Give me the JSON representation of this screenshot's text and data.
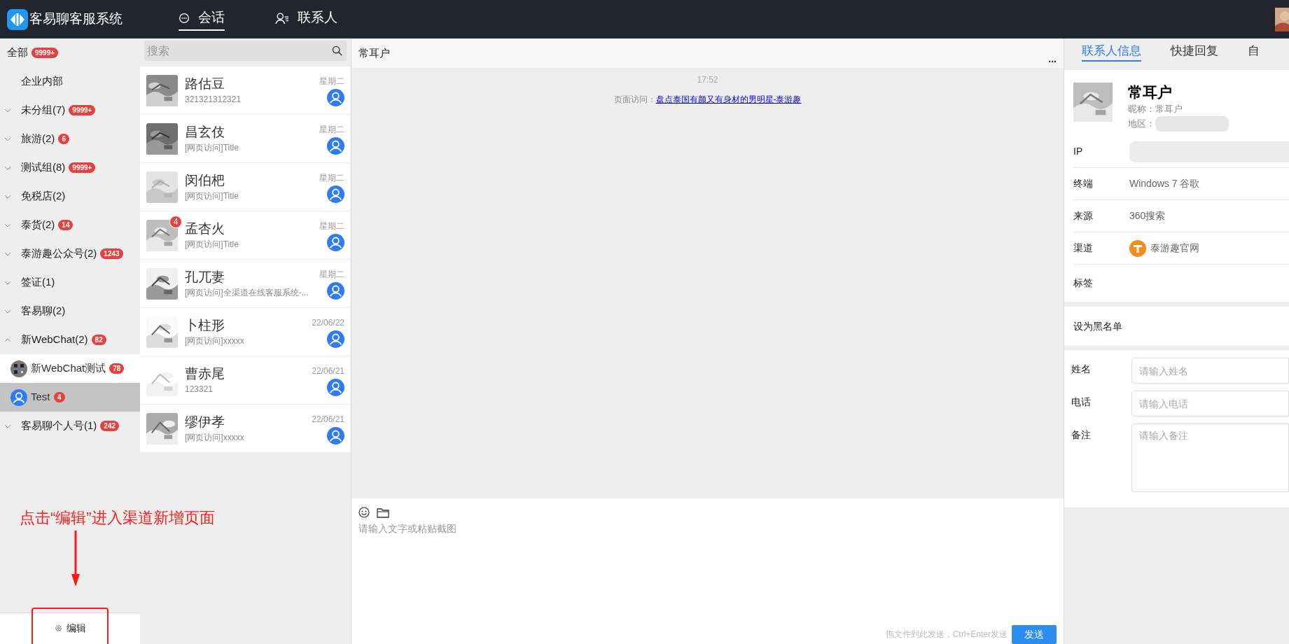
{
  "app": {
    "title": "客易聊客服系统"
  },
  "nav_tabs": [
    {
      "label": "会话",
      "kind": "chat",
      "selected": true
    },
    {
      "label": "联系人",
      "kind": "contacts",
      "selected": false
    }
  ],
  "sidebar": {
    "items": [
      {
        "label": "全部",
        "badge": "9999+",
        "kind": "plain",
        "selected": false
      },
      {
        "label": "企业内部",
        "kind": "plain",
        "selected": false
      },
      {
        "label": "未分组(7)",
        "badge": "9999+",
        "kind": "group",
        "expanded": false,
        "selected": false
      },
      {
        "label": "旅游(2)",
        "badge": "6",
        "kind": "group",
        "expanded": false,
        "selected": false
      },
      {
        "label": "测试组(8)",
        "badge": "9999+",
        "kind": "group",
        "expanded": false,
        "selected": false
      },
      {
        "label": "免税店(2)",
        "kind": "group",
        "expanded": false,
        "selected": false
      },
      {
        "label": "泰货(2)",
        "badge": "14",
        "kind": "group",
        "expanded": false,
        "selected": false
      },
      {
        "label": "泰游趣公众号(2)",
        "badge": "1243",
        "kind": "group",
        "expanded": false,
        "selected": false
      },
      {
        "label": "签证(1)",
        "kind": "group",
        "expanded": false,
        "selected": false
      },
      {
        "label": "客易聊(2)",
        "kind": "group",
        "expanded": false,
        "selected": false
      },
      {
        "label": "新WebChat(2)",
        "badge": "82",
        "kind": "group",
        "expanded": true,
        "selected": false,
        "children": [
          {
            "label": "新WebChat测试",
            "badge": "78",
            "kind": "qr",
            "selected": false
          },
          {
            "label": "Test",
            "badge": "4",
            "kind": "person",
            "selected": true
          }
        ]
      },
      {
        "label": "客易聊个人号(1)",
        "badge": "242",
        "kind": "group",
        "expanded": false,
        "selected": false
      }
    ],
    "edit_button": "编辑"
  },
  "search": {
    "placeholder": "搜索"
  },
  "conversations": [
    {
      "name": "路估豆",
      "preview": "321321312321",
      "time": "星期二"
    },
    {
      "name": "昌玄伎",
      "preview": "[网页访问]Title",
      "time": "星期二"
    },
    {
      "name": "闵伯杷",
      "preview": "[网页访问]Title",
      "time": "星期二"
    },
    {
      "name": "孟杏火",
      "preview": "[网页访问]Title",
      "time": "星期二",
      "unread": "4"
    },
    {
      "name": "孔兀妻",
      "preview": "[网页访问]全渠道在线客服系统-...",
      "time": "星期二"
    },
    {
      "name": "卜柱形",
      "preview": "[网页访问]xxxxx",
      "time": "22/06/22"
    },
    {
      "name": "曹赤尾",
      "preview": "123321",
      "time": "22/06/21"
    },
    {
      "name": "缪伊孝",
      "preview": "[网页访问]xxxxx",
      "time": "22/06/21"
    }
  ],
  "chat": {
    "title": "常耳户",
    "more": "...",
    "messages": [
      {
        "kind": "time",
        "text": "17:52"
      },
      {
        "kind": "visit",
        "label": "页面访问：",
        "link": "盘点泰国有颜又有身材的男明星-泰游趣"
      }
    ],
    "input_placeholder": "请输入文字或粘贴截图",
    "hint": "拖文件到此发送，Ctrl+Enter发送",
    "send_button": "发送"
  },
  "right_panel": {
    "tabs": [
      {
        "label": "联系人信息",
        "selected": true
      },
      {
        "label": "快捷回复",
        "selected": false
      },
      {
        "label": "自",
        "selected": false
      }
    ],
    "name": "常耳户",
    "nickname": "昵称：常耳户",
    "region_label": "地区：",
    "info_rows": [
      {
        "label": "IP",
        "kind": "redacted"
      },
      {
        "label": "终端",
        "kind": "text",
        "value": "Windows 7 谷歌"
      },
      {
        "label": "来源",
        "kind": "text",
        "value": "360搜索"
      },
      {
        "label": "渠道",
        "kind": "channel",
        "value": "泰游趣官网"
      },
      {
        "label": "标签",
        "kind": "text"
      }
    ],
    "blacklist": "设为黑名单",
    "form": [
      {
        "label": "姓名",
        "placeholder": "请输入姓名",
        "kind": "input"
      },
      {
        "label": "电话",
        "placeholder": "请输入电话",
        "kind": "input"
      },
      {
        "label": "备注",
        "placeholder": "请输入备注",
        "kind": "textarea"
      }
    ]
  },
  "annotation": {
    "text": "点击“编辑”进入渠道新增页面"
  }
}
